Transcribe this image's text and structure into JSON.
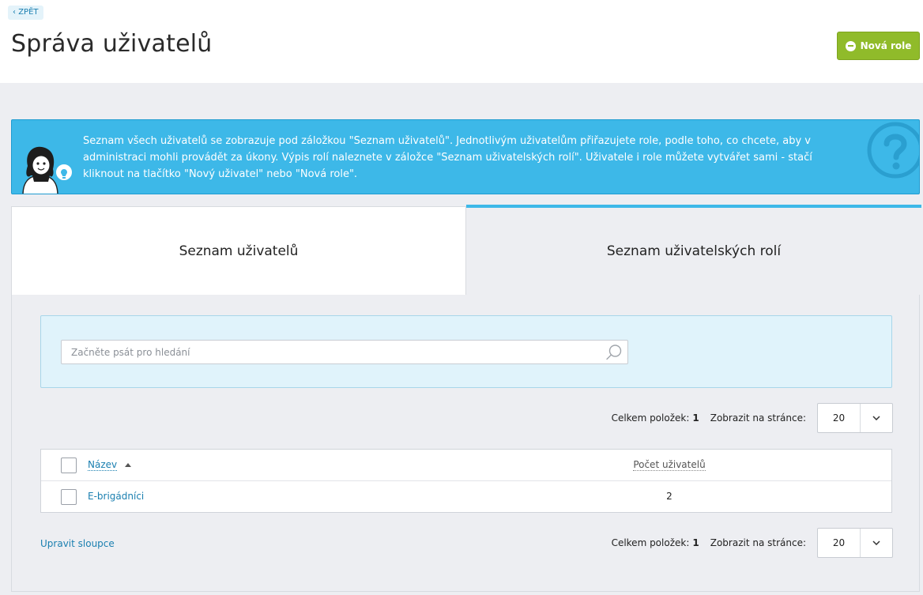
{
  "header": {
    "back_label": "ZPĚT",
    "title": "Správa uživatelů",
    "new_role_label": "Nová role"
  },
  "info": {
    "text": "Seznam všech uživatelů se zobrazuje pod záložkou \"Seznam uživatelů\". Jednotlivým uživatelům přiřazujete role, podle toho, co chcete, aby v administraci mohli provádět za úkony. Výpis rolí naleznete v záložce \"Seznam uživatelských rolí\". Uživatele i role můžete vytvářet sami - stačí kliknout na tlačítko \"Nový uživatel\" nebo \"Nová role\"."
  },
  "tabs": [
    {
      "label": "Seznam uživatelů"
    },
    {
      "label": "Seznam uživatelských rolí"
    }
  ],
  "search": {
    "placeholder": "Začněte psát pro hledání"
  },
  "pager": {
    "count_label": "Celkem položek:",
    "count_value": "1",
    "per_page_label": "Zobrazit na stránce:",
    "per_page_value": "20"
  },
  "table": {
    "columns": {
      "name": "Název",
      "count": "Počet uživatelů"
    },
    "rows": [
      {
        "name": "E-brigádníci",
        "count": "2"
      }
    ]
  },
  "footer": {
    "edit_columns_label": "Upravit sloupce"
  },
  "colors": {
    "accent": "#3db8e8",
    "button_green": "#90bb2a",
    "link": "#1a7fb0"
  }
}
